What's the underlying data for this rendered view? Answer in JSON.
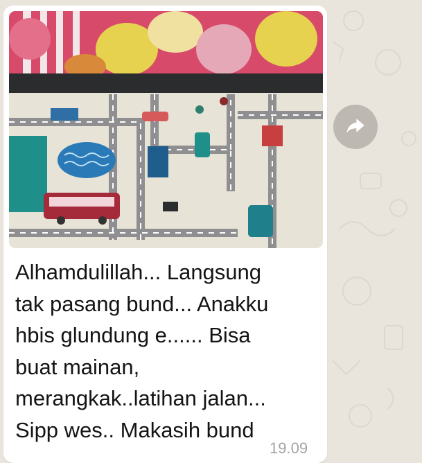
{
  "chat": {
    "message": {
      "caption": "Alhamdulillah... Langsung\ntak pasang bund... Anakku\nhbis glundung e...... Bisa\nbuat mainan,\nmerangkak..latihan jalan...\nSipp wes.. Makasih bund",
      "time": "19.09",
      "image_icon": "photo-of-play-mat"
    },
    "forward_button": {
      "icon": "share-forward-icon"
    }
  },
  "colors": {
    "wallpaper": "#e9e4dc",
    "bubble": "#ffffff",
    "text": "#141414",
    "timestamp": "#a4a4a4",
    "forward_button": "#bdb8b1"
  }
}
